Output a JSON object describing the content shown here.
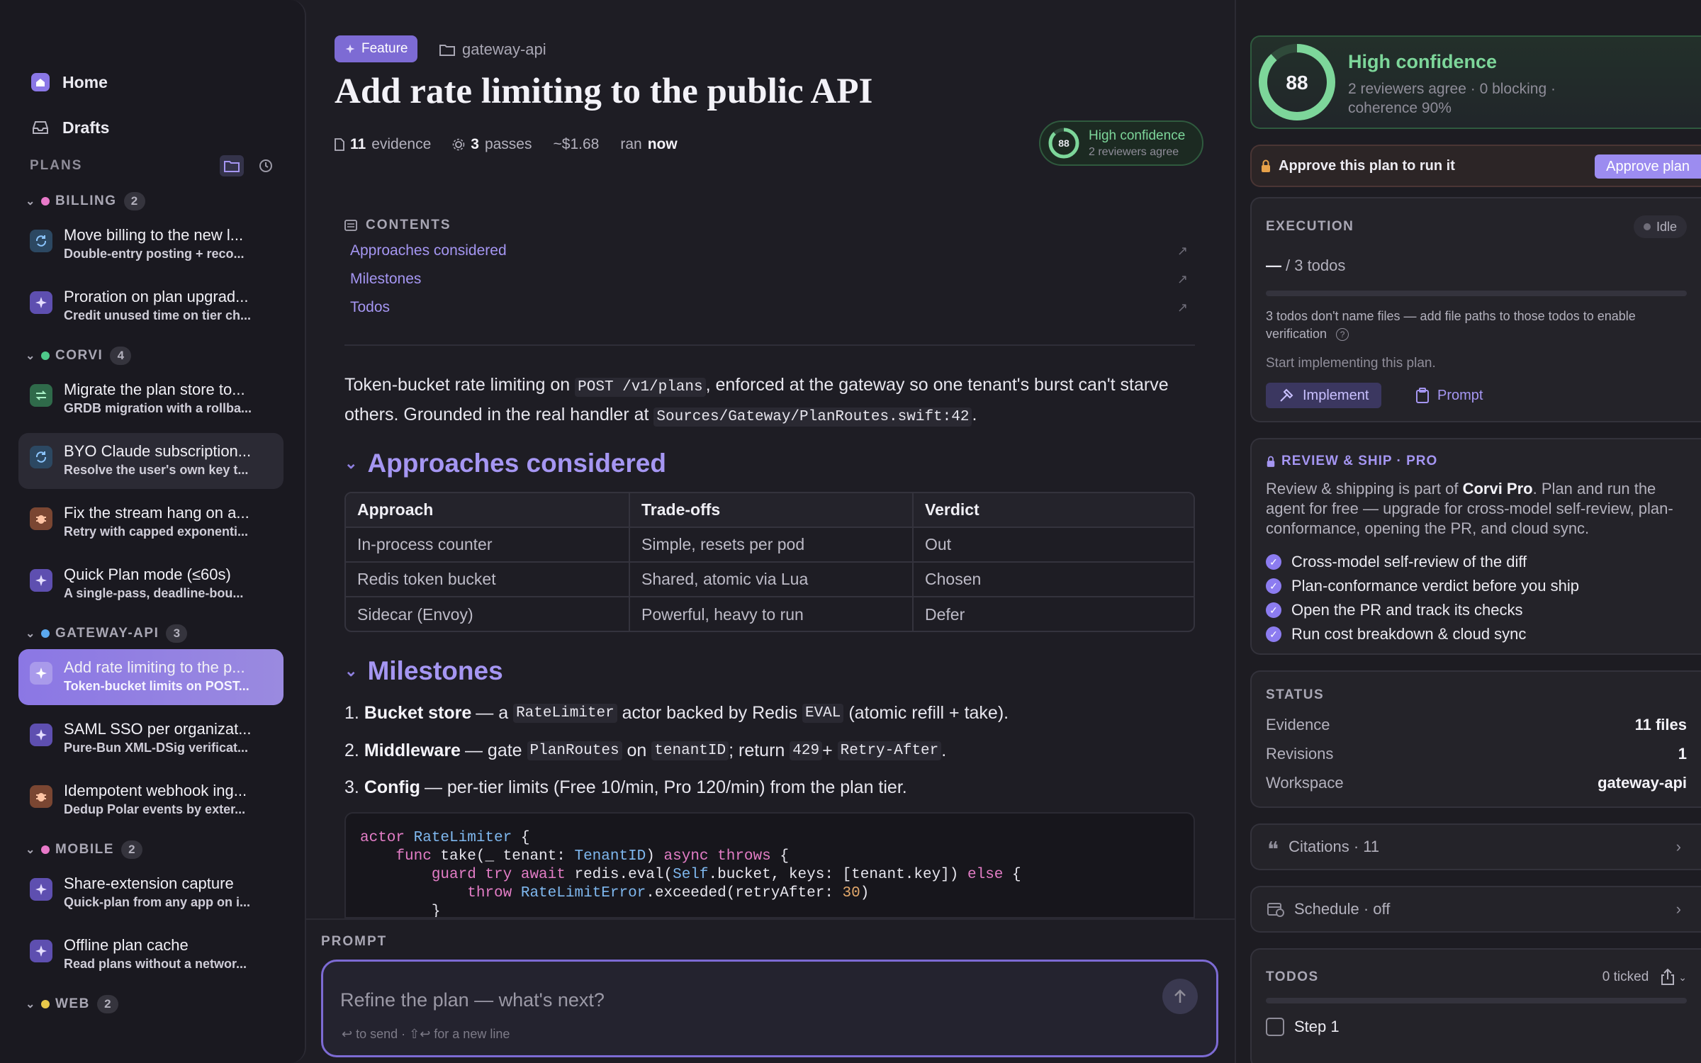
{
  "sidebar": {
    "nav": [
      {
        "label": "Home",
        "icon": "home-icon"
      },
      {
        "label": "Drafts",
        "icon": "inbox-icon"
      }
    ],
    "plans_label": "PLANS",
    "groups": [
      {
        "name": "BILLING",
        "count": "2",
        "color": "#e879c9",
        "items": [
          {
            "title": "Move billing to the new l...",
            "subtitle": "Double-entry posting + reco...",
            "icon_color": "#5ba9f0",
            "icon": "refresh-icon"
          },
          {
            "title": "Proration on plan upgrad...",
            "subtitle": "Credit unused time on tier ch...",
            "icon_color": "#8a77e6",
            "icon": "sparkle-icon"
          }
        ]
      },
      {
        "name": "CORVI",
        "count": "4",
        "color": "#4ec98a",
        "items": [
          {
            "title": "Migrate the plan store to...",
            "subtitle": "GRDB migration with a rollba...",
            "icon_color": "#4ec98a",
            "icon": "migrate-icon"
          },
          {
            "title": "BYO Claude subscription...",
            "subtitle": "Resolve the user's own key t...",
            "icon_color": "#5ba9f0",
            "icon": "refresh-icon"
          },
          {
            "title": "Fix the stream hang on a...",
            "subtitle": "Retry with capped exponenti...",
            "icon_color": "#e8875a",
            "icon": "bug-icon"
          },
          {
            "title": "Quick Plan mode (≤60s)",
            "subtitle": "A single-pass, deadline-bou...",
            "icon_color": "#8a77e6",
            "icon": "sparkle-icon"
          }
        ]
      },
      {
        "name": "GATEWAY-API",
        "count": "3",
        "color": "#5ba9f0",
        "items": [
          {
            "title": "Add rate limiting to the p...",
            "subtitle": "Token-bucket limits on POST...",
            "icon_color": "#ffffff",
            "icon": "sparkle-icon"
          },
          {
            "title": "SAML SSO per organizat...",
            "subtitle": "Pure-Bun XML-DSig verificat...",
            "icon_color": "#8a77e6",
            "icon": "sparkle-icon"
          },
          {
            "title": "Idempotent webhook ing...",
            "subtitle": "Dedup Polar events by exter...",
            "icon_color": "#e8875a",
            "icon": "bug-icon"
          }
        ]
      },
      {
        "name": "MOBILE",
        "count": "2",
        "color": "#e879c9",
        "items": [
          {
            "title": "Share-extension capture",
            "subtitle": "Quick-plan from any app on i...",
            "icon_color": "#8a77e6",
            "icon": "sparkle-icon"
          },
          {
            "title": "Offline plan cache",
            "subtitle": "Read plans without a networ...",
            "icon_color": "#8a77e6",
            "icon": "sparkle-icon"
          }
        ]
      },
      {
        "name": "WEB",
        "count": "2",
        "color": "#e8c84a",
        "items": []
      }
    ]
  },
  "header": {
    "badge": "Feature",
    "workspace": "gateway-api",
    "title": "Add rate limiting to the public API",
    "meta": {
      "evidence_count": "11",
      "evidence_label": "evidence",
      "passes_count": "3",
      "passes_label": "passes",
      "cost": "~$1.68",
      "ran_label": "ran",
      "ran_value": "now"
    },
    "confidence": {
      "score": "88",
      "score_value": 88,
      "label": "High confidence",
      "sub": "2 reviewers agree"
    }
  },
  "contents": {
    "label": "CONTENTS",
    "items": [
      "Approaches considered",
      "Milestones",
      "Todos"
    ]
  },
  "intro": {
    "p1": "Token-bucket rate limiting on ",
    "code1": "POST /v1/plans",
    "p2": ", enforced at the gateway so one tenant's burst can't starve others. Grounded in the real handler at ",
    "code2": "Sources/Gateway/PlanRoutes.swift:42",
    "p3": "."
  },
  "approaches": {
    "heading": "Approaches considered",
    "columns": [
      "Approach",
      "Trade-offs",
      "Verdict"
    ],
    "rows": [
      [
        "In-process counter",
        "Simple, resets per pod",
        "Out"
      ],
      [
        "Redis token bucket",
        "Shared, atomic via Lua",
        "Chosen"
      ],
      [
        "Sidecar (Envoy)",
        "Powerful, heavy to run",
        "Defer"
      ]
    ]
  },
  "milestones": {
    "heading": "Milestones",
    "m1": {
      "num": "1.",
      "title": "Bucket store",
      "a": " — a ",
      "c1": "RateLimiter",
      "b": " actor backed by Redis ",
      "c2": "EVAL",
      "d": " (atomic refill + take)."
    },
    "m2": {
      "num": "2.",
      "title": "Middleware",
      "a": " — gate ",
      "c1": "PlanRoutes",
      "b": " on ",
      "c2": "tenantID",
      "d": "; return ",
      "c3": "429",
      "e": " + ",
      "c4": "Retry-After",
      "f": "."
    },
    "m3": {
      "num": "3.",
      "title": "Config",
      "a": " — per-tier limits (Free 10/min, Pro 120/min) from the plan tier."
    }
  },
  "code": {
    "l1a": "actor",
    "l1b": " RateLimiter",
    "l1c": " {",
    "l2a": "    func",
    "l2b": " take(_ tenant: ",
    "l2c": "TenantID",
    "l2d": ") ",
    "l2e": "async throws",
    "l2f": " {",
    "l3a": "        guard try await",
    "l3b": " redis.eval(",
    "l3c": "Self",
    "l3d": ".bucket, keys: [tenant.key]) ",
    "l3e": "else",
    "l3f": " {",
    "l4a": "            throw",
    "l4b": " RateLimitError",
    "l4c": ".exceeded(retryAfter: ",
    "l4d": "30",
    "l4e": ")",
    "l5": "        }"
  },
  "prompt": {
    "label": "PROMPT",
    "placeholder": "Refine the plan — what's next?",
    "hint": "↩ to send · ⇧↩ for a new line"
  },
  "right": {
    "confidence": {
      "score": "88",
      "score_value": 88,
      "title": "High confidence",
      "line1": "2 reviewers agree · 0 blocking ·",
      "line2": "coherence 90%"
    },
    "approve": {
      "label": "Approve this plan to run it",
      "button": "Approve plan"
    },
    "execution": {
      "title": "EXECUTION",
      "status": "Idle",
      "todos_dash": "—",
      "todos_label": "/ 3 todos",
      "warning": "3 todos don't name files — add file paths to those todos to enable verification",
      "start": "Start implementing this plan.",
      "implement": "Implement",
      "prompt": "Prompt"
    },
    "review": {
      "title": "REVIEW & SHIP · PRO",
      "desc_a": "Review & shipping is part of ",
      "desc_b": "Corvi Pro",
      "desc_c": ". Plan and run the agent for free — upgrade for cross-model self-review, plan-conformance, opening the PR, and cloud sync.",
      "items": [
        "Cross-model self-review of the diff",
        "Plan-conformance verdict before you ship",
        "Open the PR and track its checks",
        "Run cost breakdown & cloud sync"
      ]
    },
    "status": {
      "title": "STATUS",
      "rows": [
        {
          "k": "Evidence",
          "v": "11 files"
        },
        {
          "k": "Revisions",
          "v": "1"
        },
        {
          "k": "Workspace",
          "v": "gateway-api"
        }
      ]
    },
    "citations": "Citations · 11",
    "schedule": "Schedule · off",
    "todos": {
      "title": "TODOS",
      "ticked": "0 ticked",
      "step": "Step 1"
    }
  },
  "colors": {
    "accent": "#8b77e4",
    "success": "#4ec98a",
    "link": "#a596f2"
  }
}
